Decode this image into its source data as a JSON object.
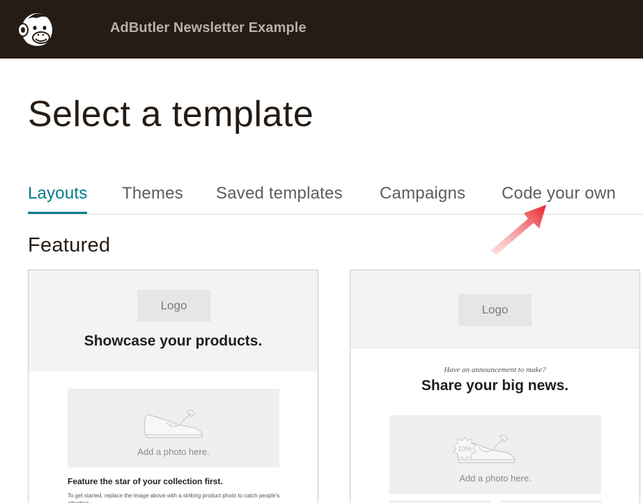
{
  "header": {
    "app_title": "AdButler Newsletter Example",
    "logo_icon": "mailchimp-freddie-icon"
  },
  "page": {
    "title": "Select a template"
  },
  "tabs": [
    {
      "label": "Layouts",
      "active": true
    },
    {
      "label": "Themes",
      "active": false
    },
    {
      "label": "Saved templates",
      "active": false
    },
    {
      "label": "Campaigns",
      "active": false
    },
    {
      "label": "Code your own",
      "active": false
    }
  ],
  "annotation": {
    "arrow_icon": "red-arrow-icon",
    "arrow_color": "#e8212b"
  },
  "featured": {
    "title": "Featured",
    "cards": [
      {
        "logo_label": "Logo",
        "headline": "Showcase your products.",
        "photo_caption": "Add a photo here.",
        "feature_title": "Feature the star of your collection first.",
        "feature_body": "To get started, replace the image above with a striking product photo to catch people's attention."
      },
      {
        "logo_label": "Logo",
        "kicker": "Have an announcement to make?",
        "headline": "Share your big news.",
        "photo_caption": "Add a photo here.",
        "badge": "10%"
      }
    ]
  },
  "colors": {
    "topbar": "#241c15",
    "accent": "#007c89",
    "tab_text": "#5d5d5d"
  }
}
